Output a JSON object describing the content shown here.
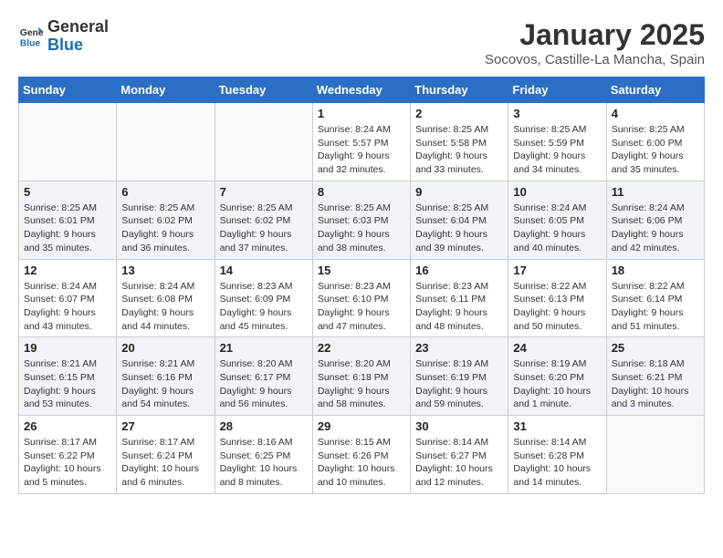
{
  "header": {
    "logo_line1": "General",
    "logo_line2": "Blue",
    "title": "January 2025",
    "subtitle": "Socovos, Castille-La Mancha, Spain"
  },
  "weekdays": [
    "Sunday",
    "Monday",
    "Tuesday",
    "Wednesday",
    "Thursday",
    "Friday",
    "Saturday"
  ],
  "weeks": [
    [
      {
        "day": "",
        "info": ""
      },
      {
        "day": "",
        "info": ""
      },
      {
        "day": "",
        "info": ""
      },
      {
        "day": "1",
        "info": "Sunrise: 8:24 AM\nSunset: 5:57 PM\nDaylight: 9 hours and 32 minutes."
      },
      {
        "day": "2",
        "info": "Sunrise: 8:25 AM\nSunset: 5:58 PM\nDaylight: 9 hours and 33 minutes."
      },
      {
        "day": "3",
        "info": "Sunrise: 8:25 AM\nSunset: 5:59 PM\nDaylight: 9 hours and 34 minutes."
      },
      {
        "day": "4",
        "info": "Sunrise: 8:25 AM\nSunset: 6:00 PM\nDaylight: 9 hours and 35 minutes."
      }
    ],
    [
      {
        "day": "5",
        "info": "Sunrise: 8:25 AM\nSunset: 6:01 PM\nDaylight: 9 hours and 35 minutes."
      },
      {
        "day": "6",
        "info": "Sunrise: 8:25 AM\nSunset: 6:02 PM\nDaylight: 9 hours and 36 minutes."
      },
      {
        "day": "7",
        "info": "Sunrise: 8:25 AM\nSunset: 6:02 PM\nDaylight: 9 hours and 37 minutes."
      },
      {
        "day": "8",
        "info": "Sunrise: 8:25 AM\nSunset: 6:03 PM\nDaylight: 9 hours and 38 minutes."
      },
      {
        "day": "9",
        "info": "Sunrise: 8:25 AM\nSunset: 6:04 PM\nDaylight: 9 hours and 39 minutes."
      },
      {
        "day": "10",
        "info": "Sunrise: 8:24 AM\nSunset: 6:05 PM\nDaylight: 9 hours and 40 minutes."
      },
      {
        "day": "11",
        "info": "Sunrise: 8:24 AM\nSunset: 6:06 PM\nDaylight: 9 hours and 42 minutes."
      }
    ],
    [
      {
        "day": "12",
        "info": "Sunrise: 8:24 AM\nSunset: 6:07 PM\nDaylight: 9 hours and 43 minutes."
      },
      {
        "day": "13",
        "info": "Sunrise: 8:24 AM\nSunset: 6:08 PM\nDaylight: 9 hours and 44 minutes."
      },
      {
        "day": "14",
        "info": "Sunrise: 8:23 AM\nSunset: 6:09 PM\nDaylight: 9 hours and 45 minutes."
      },
      {
        "day": "15",
        "info": "Sunrise: 8:23 AM\nSunset: 6:10 PM\nDaylight: 9 hours and 47 minutes."
      },
      {
        "day": "16",
        "info": "Sunrise: 8:23 AM\nSunset: 6:11 PM\nDaylight: 9 hours and 48 minutes."
      },
      {
        "day": "17",
        "info": "Sunrise: 8:22 AM\nSunset: 6:13 PM\nDaylight: 9 hours and 50 minutes."
      },
      {
        "day": "18",
        "info": "Sunrise: 8:22 AM\nSunset: 6:14 PM\nDaylight: 9 hours and 51 minutes."
      }
    ],
    [
      {
        "day": "19",
        "info": "Sunrise: 8:21 AM\nSunset: 6:15 PM\nDaylight: 9 hours and 53 minutes."
      },
      {
        "day": "20",
        "info": "Sunrise: 8:21 AM\nSunset: 6:16 PM\nDaylight: 9 hours and 54 minutes."
      },
      {
        "day": "21",
        "info": "Sunrise: 8:20 AM\nSunset: 6:17 PM\nDaylight: 9 hours and 56 minutes."
      },
      {
        "day": "22",
        "info": "Sunrise: 8:20 AM\nSunset: 6:18 PM\nDaylight: 9 hours and 58 minutes."
      },
      {
        "day": "23",
        "info": "Sunrise: 8:19 AM\nSunset: 6:19 PM\nDaylight: 9 hours and 59 minutes."
      },
      {
        "day": "24",
        "info": "Sunrise: 8:19 AM\nSunset: 6:20 PM\nDaylight: 10 hours and 1 minute."
      },
      {
        "day": "25",
        "info": "Sunrise: 8:18 AM\nSunset: 6:21 PM\nDaylight: 10 hours and 3 minutes."
      }
    ],
    [
      {
        "day": "26",
        "info": "Sunrise: 8:17 AM\nSunset: 6:22 PM\nDaylight: 10 hours and 5 minutes."
      },
      {
        "day": "27",
        "info": "Sunrise: 8:17 AM\nSunset: 6:24 PM\nDaylight: 10 hours and 6 minutes."
      },
      {
        "day": "28",
        "info": "Sunrise: 8:16 AM\nSunset: 6:25 PM\nDaylight: 10 hours and 8 minutes."
      },
      {
        "day": "29",
        "info": "Sunrise: 8:15 AM\nSunset: 6:26 PM\nDaylight: 10 hours and 10 minutes."
      },
      {
        "day": "30",
        "info": "Sunrise: 8:14 AM\nSunset: 6:27 PM\nDaylight: 10 hours and 12 minutes."
      },
      {
        "day": "31",
        "info": "Sunrise: 8:14 AM\nSunset: 6:28 PM\nDaylight: 10 hours and 14 minutes."
      },
      {
        "day": "",
        "info": ""
      }
    ]
  ]
}
